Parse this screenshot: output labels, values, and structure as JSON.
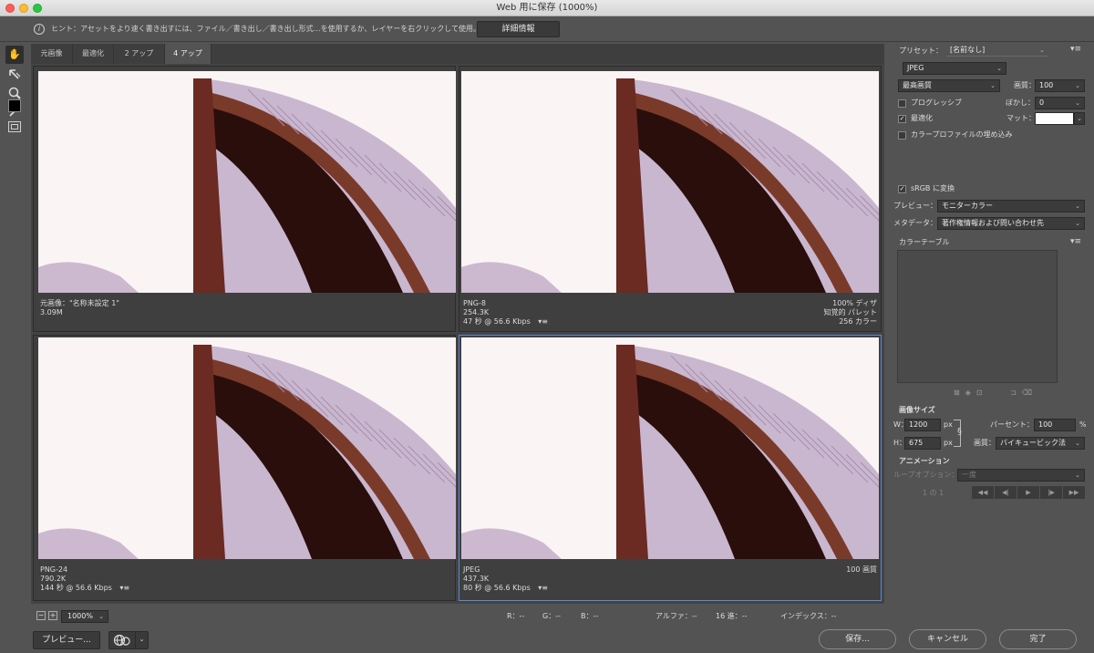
{
  "window": {
    "title": "Web 用に保存 (1000%)"
  },
  "hint": {
    "text": "ヒント：アセットをより速く書き出すには、ファイル／書き出し／書き出し形式…を使用するか、レイヤーを右クリックして使用。",
    "details_button": "詳細情報"
  },
  "tabs": [
    {
      "label": "元画像",
      "active": false
    },
    {
      "label": "最適化",
      "active": false
    },
    {
      "label": "2 アップ",
      "active": false
    },
    {
      "label": "4 アップ",
      "active": true
    }
  ],
  "panes": [
    {
      "left": [
        "元画像：\"名称未設定 1\"",
        "3.09M",
        ""
      ],
      "right": [
        "",
        "",
        ""
      ],
      "menu": false,
      "selected": false
    },
    {
      "left": [
        "PNG-8",
        "254.3K",
        "47 秒 @ 56.6 Kbps"
      ],
      "right": [
        "100% ディザ",
        "知覚的 パレット",
        "256 カラー"
      ],
      "menu": true,
      "selected": false
    },
    {
      "left": [
        "PNG-24",
        "790.2K",
        "144 秒 @ 56.6 Kbps"
      ],
      "right": [
        "",
        "",
        ""
      ],
      "menu": true,
      "selected": false
    },
    {
      "left": [
        "JPEG",
        "437.3K",
        "80 秒 @ 56.6 Kbps"
      ],
      "right": [
        "100 画質",
        "",
        ""
      ],
      "menu": true,
      "selected": true
    }
  ],
  "status": {
    "zoom": "1000%",
    "r": "R：--",
    "g": "G：--",
    "b": "B：--",
    "alpha": "アルファ：--",
    "hex": "16 進：--",
    "index": "インデックス：--"
  },
  "bottom": {
    "preview": "プレビュー...",
    "save": "保存...",
    "cancel": "キャンセル",
    "done": "完了"
  },
  "settings": {
    "preset_label": "プリセット：",
    "preset_value": "[名前なし]",
    "format": "JPEG",
    "quality_preset": "最高画質",
    "quality_label": "画質：",
    "quality_value": "100",
    "progressive": "プログレッシブ",
    "progressive_checked": false,
    "blur_label": "ぼかし：",
    "blur_value": "0",
    "optimize": "最適化",
    "optimize_checked": true,
    "matte_label": "マット：",
    "embed_profile": "カラープロファイルの埋め込み",
    "embed_checked": false,
    "srgb": "sRGB に変換",
    "srgb_checked": true,
    "preview_label": "プレビュー：",
    "preview_value": "モニターカラー",
    "metadata_label": "メタデータ：",
    "metadata_value": "著作権情報および問い合わせ先",
    "color_table": "カラーテーブル",
    "image_size": "画像サイズ",
    "w_label": "W：",
    "w_value": "1200",
    "h_label": "H：",
    "h_value": "675",
    "px": "px",
    "percent_label": "パーセント：",
    "percent_value": "100",
    "percent_unit": "%",
    "resample_label": "画質：",
    "resample_value": "バイキュービック法",
    "animation": "アニメーション",
    "loop_label": "ループオプション：",
    "loop_value": "一度",
    "frame": "1 の 1"
  }
}
